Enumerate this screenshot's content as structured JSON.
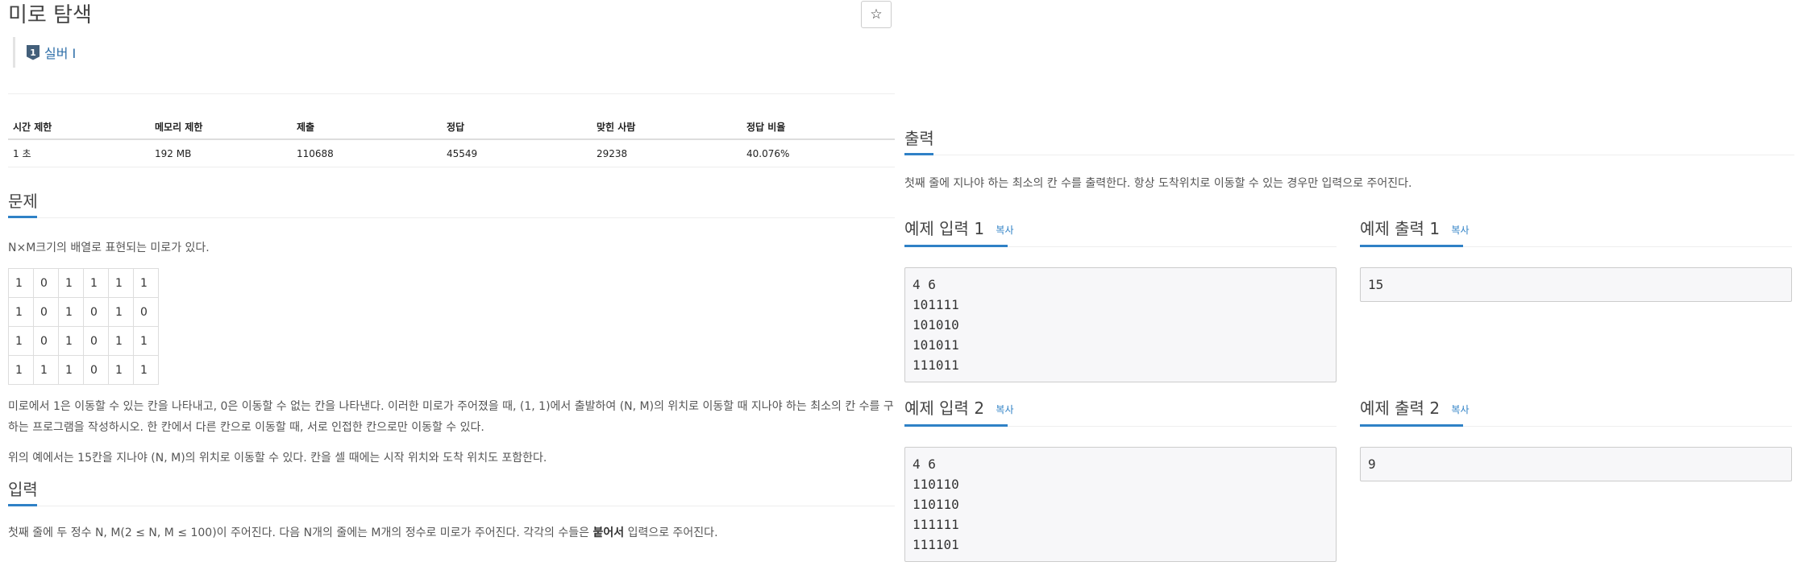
{
  "problem": {
    "title": "미로 탐색",
    "star_icon": "☆",
    "tier": {
      "badge": "1",
      "label": "실버 I"
    }
  },
  "info_table": {
    "headers": [
      "시간 제한",
      "메모리 제한",
      "제출",
      "정답",
      "맞힌 사람",
      "정답 비율"
    ],
    "values": [
      "1 초",
      "192 MB",
      "110688",
      "45549",
      "29238",
      "40.076%"
    ]
  },
  "sections": {
    "problem": {
      "heading": "문제",
      "intro": "N×M크기의 배열로 표현되는 미로가 있다.",
      "maze": [
        [
          "1",
          "0",
          "1",
          "1",
          "1",
          "1"
        ],
        [
          "1",
          "0",
          "1",
          "0",
          "1",
          "0"
        ],
        [
          "1",
          "0",
          "1",
          "0",
          "1",
          "1"
        ],
        [
          "1",
          "1",
          "1",
          "0",
          "1",
          "1"
        ]
      ],
      "desc1": "미로에서 1은 이동할 수 있는 칸을 나타내고, 0은 이동할 수 없는 칸을 나타낸다. 이러한 미로가 주어졌을 때, (1, 1)에서 출발하여 (N, M)의 위치로 이동할 때 지나야 하는 최소의 칸 수를 구하는 프로그램을 작성하시오. 한 칸에서 다른 칸으로 이동할 때, 서로 인접한 칸으로만 이동할 수 있다.",
      "desc2": "위의 예에서는 15칸을 지나야 (N, M)의 위치로 이동할 수 있다. 칸을 셀 때에는 시작 위치와 도착 위치도 포함한다."
    },
    "input": {
      "heading": "입력",
      "text_before": "첫째 줄에 두 정수 N, M(2 ≤ N, M ≤ 100)이 주어진다. 다음 N개의 줄에는 M개의 정수로 미로가 주어진다. 각각의 수들은 ",
      "text_bold": "붙어서",
      "text_after": " 입력으로 주어진다."
    },
    "output": {
      "heading": "출력",
      "text": "첫째 줄에 지나야 하는 최소의 칸 수를 출력한다. 항상 도착위치로 이동할 수 있는 경우만 입력으로 주어진다."
    }
  },
  "examples": {
    "copy_label": "복사",
    "input1": {
      "heading": "예제 입력 1",
      "content": "4 6\n101111\n101010\n101011\n111011"
    },
    "output1": {
      "heading": "예제 출력 1",
      "content": "15"
    },
    "input2": {
      "heading": "예제 입력 2",
      "content": "4 6\n110110\n110110\n111111\n111101"
    },
    "output2": {
      "heading": "예제 출력 2",
      "content": "9"
    }
  }
}
